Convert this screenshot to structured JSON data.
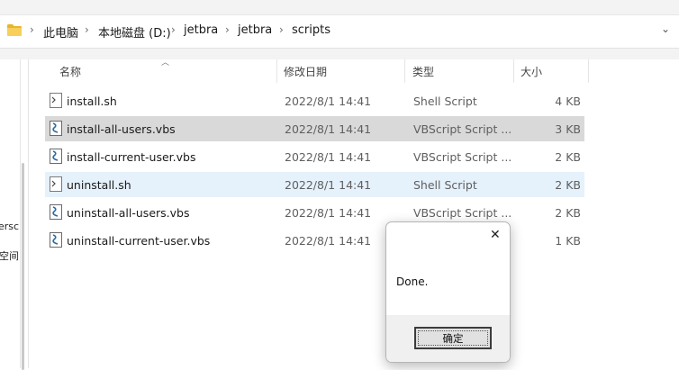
{
  "breadcrumbs": [
    "此电脑",
    "本地磁盘 (D:)",
    "jetbra",
    "jetbra",
    "scripts"
  ],
  "nav": {
    "truncated_1": "ersc",
    "truncated_2": "空间"
  },
  "columns": {
    "name": "名称",
    "date": "修改日期",
    "type": "类型",
    "size": "大小"
  },
  "files": [
    {
      "name": "install.sh",
      "date": "2022/8/1 14:41",
      "type": "Shell Script",
      "size": "4 KB"
    },
    {
      "name": "install-all-users.vbs",
      "date": "2022/8/1 14:41",
      "type": "VBScript Script ...",
      "size": "3 KB"
    },
    {
      "name": "install-current-user.vbs",
      "date": "2022/8/1 14:41",
      "type": "VBScript Script ...",
      "size": "2 KB"
    },
    {
      "name": "uninstall.sh",
      "date": "2022/8/1 14:41",
      "type": "Shell Script",
      "size": "2 KB"
    },
    {
      "name": "uninstall-all-users.vbs",
      "date": "2022/8/1 14:41",
      "type": "VBScript Script ...",
      "size": "2 KB"
    },
    {
      "name": "uninstall-current-user.vbs",
      "date": "2022/8/1 14:41",
      "type": "",
      "size": "1 KB"
    }
  ],
  "dialog": {
    "message": "Done.",
    "ok_label": "确定",
    "close_glyph": "✕"
  },
  "colors": {
    "selected_row": "#d9d9d9",
    "hover_row": "#e5f1fb",
    "folder": "#f4c542"
  }
}
